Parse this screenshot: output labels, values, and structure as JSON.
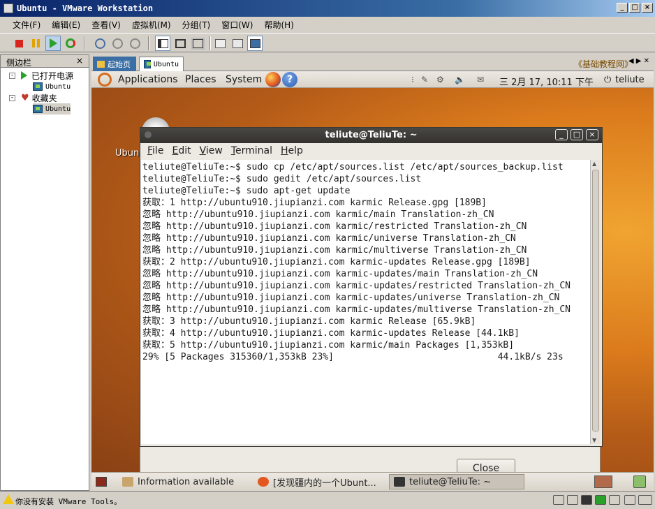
{
  "window": {
    "title": "Ubuntu - VMware Workstation",
    "controls": [
      "_",
      "□",
      "×"
    ]
  },
  "menubar": {
    "items": [
      "文件(F)",
      "编辑(E)",
      "查看(V)",
      "虚拟机(M)",
      "分组(T)",
      "窗口(W)",
      "帮助(H)"
    ]
  },
  "sidebar": {
    "title": "侧边栏",
    "close": "×",
    "groups": [
      {
        "label": "已打开电源",
        "expander": "-",
        "children": [
          "Ubuntu"
        ]
      },
      {
        "label": "收藏夹",
        "expander": "-",
        "children": [
          "Ubuntu"
        ]
      }
    ]
  },
  "vm_tabs": {
    "tabs": [
      "起始页",
      "Ubuntu"
    ],
    "link": "《基础教程网》",
    "arrows": "◀ ▶ ✕"
  },
  "gnome_panel": {
    "menus": [
      "Applications",
      "Places",
      "System"
    ],
    "help": "?",
    "clock": "三 2月 17, 10:11 下午",
    "user": "teliute"
  },
  "desktop": {
    "icon_label": "Ubun"
  },
  "terminal": {
    "title": "teliute@TeliuTe: ~",
    "controls": [
      "_",
      "□",
      "×"
    ],
    "menu": [
      {
        "label": "File",
        "mnemonic": "F",
        "rest": "ile"
      },
      {
        "label": "Edit",
        "mnemonic": "E",
        "rest": "dit"
      },
      {
        "label": "View",
        "mnemonic": "V",
        "rest": "iew"
      },
      {
        "label": "Terminal",
        "mnemonic": "T",
        "rest": "erminal"
      },
      {
        "label": "Help",
        "mnemonic": "H",
        "rest": "elp"
      }
    ],
    "lines": [
      "teliute@TeliuTe:~$ sudo cp /etc/apt/sources.list /etc/apt/sources_backup.list",
      "teliute@TeliuTe:~$ sudo gedit /etc/apt/sources.list",
      "teliute@TeliuTe:~$ sudo apt-get update",
      "获取：1 http://ubuntu910.jiupianzi.com karmic Release.gpg [189B]",
      "忽略 http://ubuntu910.jiupianzi.com karmic/main Translation-zh_CN",
      "忽略 http://ubuntu910.jiupianzi.com karmic/restricted Translation-zh_CN",
      "忽略 http://ubuntu910.jiupianzi.com karmic/universe Translation-zh_CN",
      "忽略 http://ubuntu910.jiupianzi.com karmic/multiverse Translation-zh_CN",
      "获取：2 http://ubuntu910.jiupianzi.com karmic-updates Release.gpg [189B]",
      "忽略 http://ubuntu910.jiupianzi.com karmic-updates/main Translation-zh_CN",
      "忽略 http://ubuntu910.jiupianzi.com karmic-updates/restricted Translation-zh_CN",
      "忽略 http://ubuntu910.jiupianzi.com karmic-updates/universe Translation-zh_CN",
      "忽略 http://ubuntu910.jiupianzi.com karmic-updates/multiverse Translation-zh_CN",
      "获取：3 http://ubuntu910.jiupianzi.com karmic Release [65.9kB]",
      "获取：4 http://ubuntu910.jiupianzi.com karmic-updates Release [44.1kB]",
      "获取：5 http://ubuntu910.jiupianzi.com karmic/main Packages [1,353kB]",
      "29% [5 Packages 315360/1,353kB 23%]                              44.1kB/s 23s"
    ]
  },
  "dialog": {
    "close_label": "Close"
  },
  "bottom_panel": {
    "tasks": [
      "Information available",
      "[发现疆内的一个Ubunt...",
      "teliute@TeliuTe: ~"
    ]
  },
  "statusbar": {
    "message": "你没有安装 VMware Tools。"
  },
  "colors": {
    "vmware_title": "#0a246a",
    "ubuntu_orange": "#db7b1c",
    "terminal_title": "#3c3b37"
  }
}
